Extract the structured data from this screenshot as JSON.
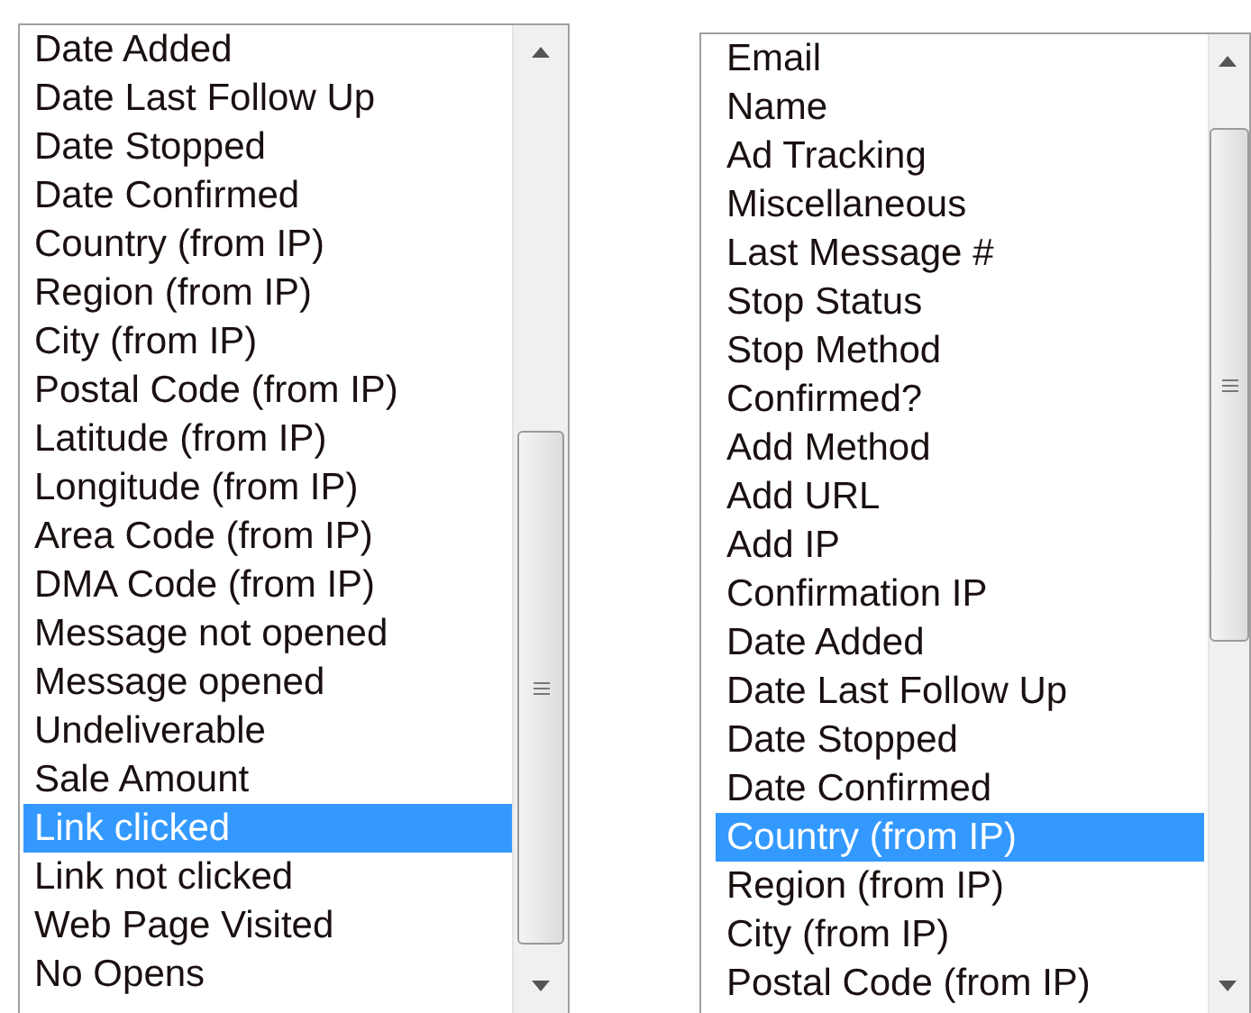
{
  "lists": [
    {
      "items": [
        {
          "label": "Date Added",
          "selected": false
        },
        {
          "label": "Date Last Follow Up",
          "selected": false
        },
        {
          "label": "Date Stopped",
          "selected": false
        },
        {
          "label": "Date Confirmed",
          "selected": false
        },
        {
          "label": "Country (from IP)",
          "selected": false
        },
        {
          "label": "Region (from IP)",
          "selected": false
        },
        {
          "label": "City (from IP)",
          "selected": false
        },
        {
          "label": "Postal Code (from IP)",
          "selected": false
        },
        {
          "label": "Latitude (from IP)",
          "selected": false
        },
        {
          "label": "Longitude (from IP)",
          "selected": false
        },
        {
          "label": "Area Code (from IP)",
          "selected": false
        },
        {
          "label": "DMA Code (from IP)",
          "selected": false
        },
        {
          "label": "Message not opened",
          "selected": false
        },
        {
          "label": "Message opened",
          "selected": false
        },
        {
          "label": "Undeliverable",
          "selected": false
        },
        {
          "label": "Sale Amount",
          "selected": false
        },
        {
          "label": "Link clicked",
          "selected": true
        },
        {
          "label": "Link not clicked",
          "selected": false
        },
        {
          "label": "Web Page Visited",
          "selected": false
        },
        {
          "label": "No Opens",
          "selected": false
        }
      ]
    },
    {
      "items": [
        {
          "label": "Email",
          "selected": false
        },
        {
          "label": "Name",
          "selected": false
        },
        {
          "label": "Ad Tracking",
          "selected": false
        },
        {
          "label": "Miscellaneous",
          "selected": false
        },
        {
          "label": "Last Message #",
          "selected": false
        },
        {
          "label": "Stop Status",
          "selected": false
        },
        {
          "label": "Stop Method",
          "selected": false
        },
        {
          "label": "Confirmed?",
          "selected": false
        },
        {
          "label": "Add Method",
          "selected": false
        },
        {
          "label": "Add URL",
          "selected": false
        },
        {
          "label": "Add IP",
          "selected": false
        },
        {
          "label": "Confirmation IP",
          "selected": false
        },
        {
          "label": "Date Added",
          "selected": false
        },
        {
          "label": "Date Last Follow Up",
          "selected": false
        },
        {
          "label": "Date Stopped",
          "selected": false
        },
        {
          "label": "Date Confirmed",
          "selected": false
        },
        {
          "label": "Country (from IP)",
          "selected": true
        },
        {
          "label": "Region (from IP)",
          "selected": false
        },
        {
          "label": "City (from IP)",
          "selected": false
        },
        {
          "label": "Postal Code (from IP)",
          "selected": false
        }
      ]
    }
  ]
}
